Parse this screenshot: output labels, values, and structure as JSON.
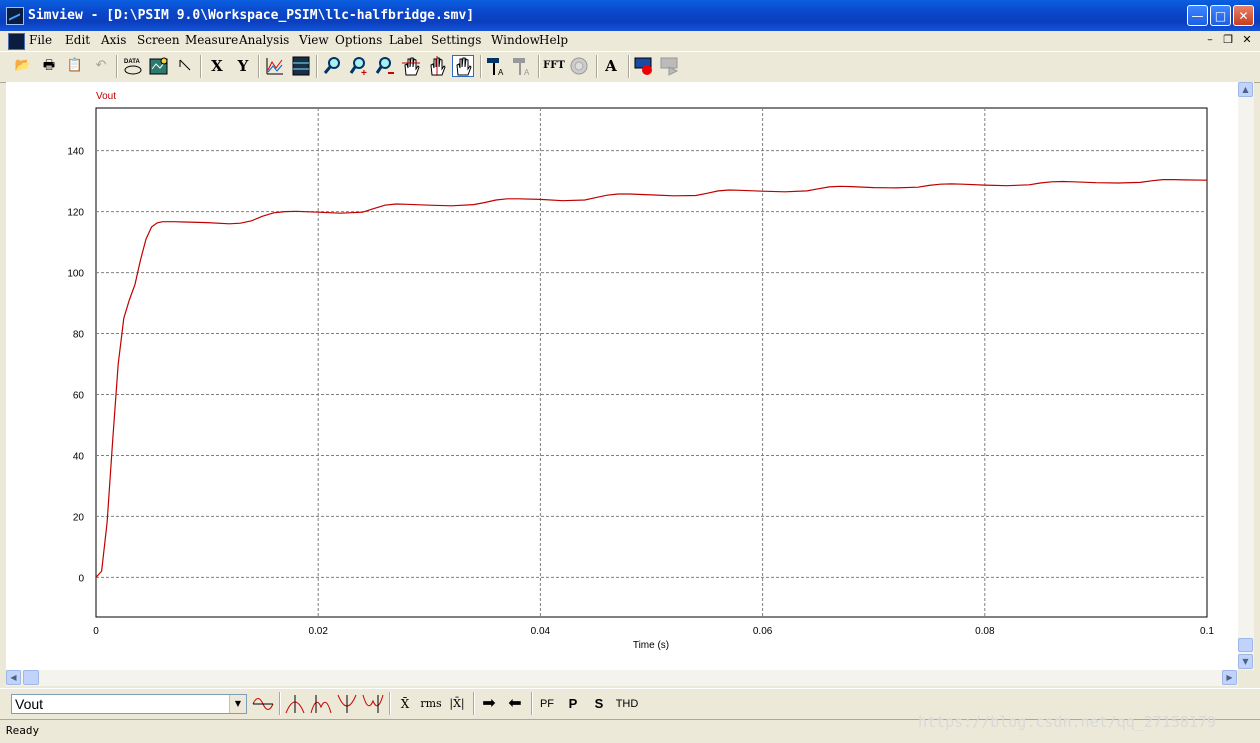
{
  "window": {
    "title": "Simview - [D:\\PSIM 9.0\\Workspace_PSIM\\llc-halfbridge.smv]",
    "minimize_glyph": "—",
    "maximize_glyph": "□",
    "close_glyph": "✕"
  },
  "menu": {
    "items": [
      "File",
      "Edit",
      "Axis",
      "Screen",
      "Measure",
      "Analysis",
      "View",
      "Options",
      "Label",
      "Settings",
      "Window",
      "Help"
    ],
    "mdi_minimize": "–",
    "mdi_restore": "❐",
    "mdi_close": "✕"
  },
  "toolbar": {
    "open_glyph": "📂",
    "print_glyph": "🖶",
    "copy_glyph": "📋",
    "undo_glyph": "↶",
    "x_label": "X",
    "y_label": "Y",
    "fft_label": "FFT",
    "text_label": "A"
  },
  "chart_data": {
    "type": "line",
    "ylabel": "Vout",
    "xlabel": "Time (s)",
    "xlim": [
      0,
      0.1
    ],
    "ylim": [
      -13,
      154
    ],
    "x_ticks": [
      0,
      0.02,
      0.04,
      0.06,
      0.08,
      0.1
    ],
    "x_tick_labels": [
      "0",
      "0.02",
      "0.04",
      "0.06",
      "0.08",
      "0.1"
    ],
    "y_ticks": [
      0,
      20,
      40,
      60,
      80,
      100,
      120,
      140
    ],
    "y_tick_labels": [
      "0",
      "20",
      "40",
      "60",
      "80",
      "100",
      "120",
      "140"
    ],
    "grid": true,
    "line_color": "#c00000",
    "series": [
      {
        "name": "Vout",
        "x": [
          0,
          0.0005,
          0.001,
          0.0015,
          0.002,
          0.0025,
          0.003,
          0.0035,
          0.004,
          0.0045,
          0.005,
          0.0055,
          0.006,
          0.007,
          0.008,
          0.01,
          0.012,
          0.013,
          0.014,
          0.015,
          0.016,
          0.017,
          0.018,
          0.02,
          0.022,
          0.024,
          0.025,
          0.026,
          0.027,
          0.028,
          0.03,
          0.032,
          0.034,
          0.035,
          0.036,
          0.037,
          0.038,
          0.04,
          0.042,
          0.044,
          0.045,
          0.046,
          0.047,
          0.048,
          0.05,
          0.052,
          0.054,
          0.055,
          0.056,
          0.057,
          0.058,
          0.06,
          0.062,
          0.064,
          0.065,
          0.066,
          0.067,
          0.068,
          0.07,
          0.072,
          0.074,
          0.075,
          0.076,
          0.077,
          0.078,
          0.08,
          0.082,
          0.084,
          0.085,
          0.086,
          0.087,
          0.088,
          0.09,
          0.092,
          0.094,
          0.095,
          0.096,
          0.097,
          0.098,
          0.1
        ],
        "values": [
          0,
          2,
          18,
          45,
          70,
          85,
          91,
          96,
          104,
          111,
          115,
          116.3,
          116.7,
          116.7,
          116.6,
          116.4,
          116,
          116.2,
          117,
          118.5,
          119.6,
          120,
          120.1,
          119.8,
          119.5,
          119.8,
          121,
          122.1,
          122.5,
          122.4,
          122.1,
          121.9,
          122.3,
          123,
          123.8,
          124.2,
          124.2,
          124,
          123.6,
          123.8,
          124.6,
          125.4,
          125.8,
          125.8,
          125.5,
          125.2,
          125.3,
          126,
          126.8,
          127.1,
          127,
          126.7,
          126.5,
          126.8,
          127.5,
          128.1,
          128.3,
          128.2,
          127.9,
          127.8,
          128,
          128.6,
          129,
          129.1,
          129,
          128.7,
          128.5,
          128.8,
          129.4,
          129.8,
          129.9,
          129.8,
          129.5,
          129.4,
          129.6,
          130.1,
          130.5,
          130.5,
          130.4,
          130.3
        ]
      }
    ]
  },
  "bottom": {
    "variable": "Vout",
    "dropdown_glyph": "▼",
    "arrow_right": "➡",
    "arrow_left": "⬅",
    "xbar_label": "X̄",
    "rms_label": "rms",
    "absavg_label": "|X̄|",
    "pf_label": "PF",
    "p_label": "P",
    "s_label": "S",
    "thd_label": "THD"
  },
  "status": {
    "text": "Ready",
    "watermark": "https://blog.csdn.net/qq_27158179"
  }
}
